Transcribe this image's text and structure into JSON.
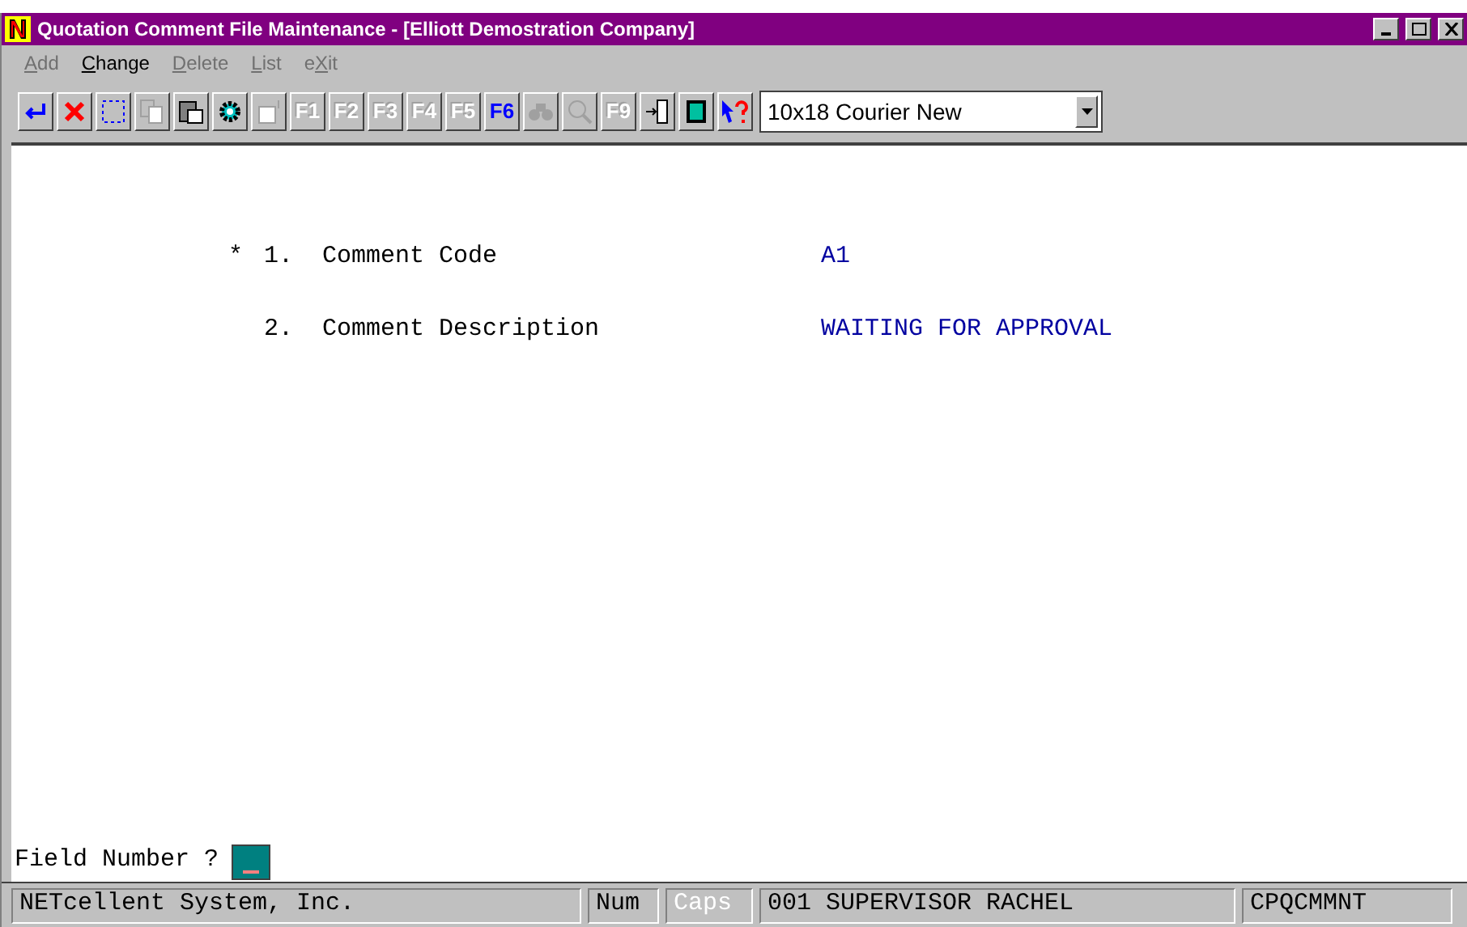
{
  "window": {
    "title": "Quotation Comment File Maintenance - [Elliott Demostration Company]"
  },
  "menu": [
    {
      "key": "A",
      "after": "dd",
      "disabled": true
    },
    {
      "key": "C",
      "after": "hange",
      "disabled": false
    },
    {
      "key": "D",
      "after": "elete",
      "disabled": true
    },
    {
      "key": "L",
      "after": "ist",
      "disabled": true
    },
    {
      "before": "e",
      "key": "X",
      "after": "it",
      "disabled": true
    }
  ],
  "toolbar": [
    {
      "kind": "enter",
      "disabled": false
    },
    {
      "kind": "cancel",
      "disabled": false
    },
    {
      "kind": "select",
      "disabled": false
    },
    {
      "kind": "copy",
      "disabled": true
    },
    {
      "kind": "paste",
      "disabled": false
    },
    {
      "kind": "gear",
      "disabled": false
    },
    {
      "kind": "properties",
      "disabled": true
    },
    {
      "kind": "key",
      "label": "F1",
      "disabled": true
    },
    {
      "kind": "key",
      "label": "F2",
      "disabled": true
    },
    {
      "kind": "key",
      "label": "F3",
      "disabled": true
    },
    {
      "kind": "key",
      "label": "F4",
      "disabled": true
    },
    {
      "kind": "key",
      "label": "F5",
      "disabled": true
    },
    {
      "kind": "key",
      "label": "F6",
      "disabled": false
    },
    {
      "kind": "binoculars",
      "disabled": true
    },
    {
      "kind": "magnifier",
      "disabled": true
    },
    {
      "kind": "key",
      "label": "F9",
      "disabled": true
    },
    {
      "kind": "door",
      "disabled": false
    },
    {
      "kind": "calculator",
      "disabled": false
    },
    {
      "kind": "help",
      "disabled": false
    }
  ],
  "font_select": {
    "value": "10x18 Courier New"
  },
  "fields": [
    {
      "marker": "*",
      "number": "1.",
      "label": "Comment Code",
      "value": "A1"
    },
    {
      "number": "2.",
      "label": "Comment Description",
      "value": "WAITING FOR APPROVAL"
    }
  ],
  "prompt": {
    "label": "Field Number ?"
  },
  "status_bar": [
    {
      "text": "NETcellent System, Inc.",
      "disabled": false
    },
    {
      "text": "Num",
      "disabled": false
    },
    {
      "text": "Caps",
      "disabled": true
    },
    {
      "text": "001 SUPERVISOR RACHEL",
      "disabled": false
    },
    {
      "text": "CPQCMMNT",
      "disabled": false
    }
  ]
}
